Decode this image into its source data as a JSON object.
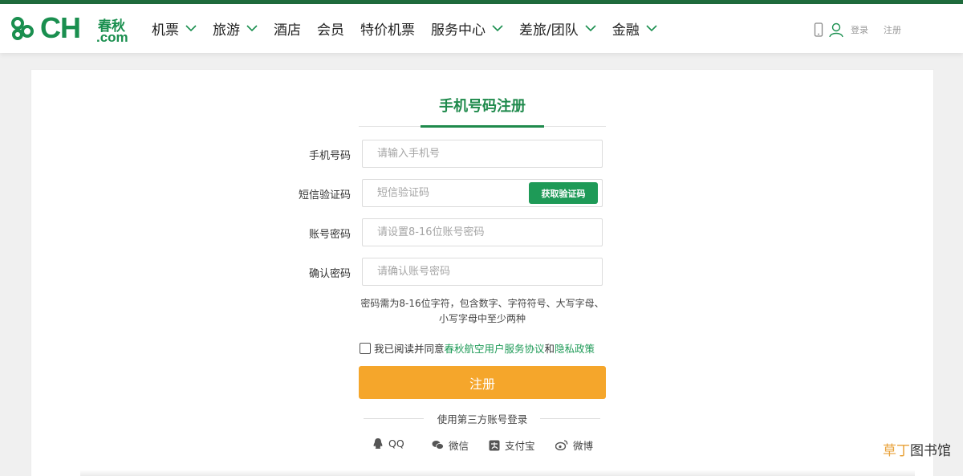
{
  "brand": {
    "logo_text": "CH",
    "logo_cn": "春秋",
    "logo_domain": ".com",
    "primary_color": "#1a8f4f",
    "accent_color": "#f5a62b"
  },
  "nav": [
    {
      "label": "机票",
      "dropdown": true
    },
    {
      "label": "旅游",
      "dropdown": true
    },
    {
      "label": "酒店",
      "dropdown": false
    },
    {
      "label": "会员",
      "dropdown": false
    },
    {
      "label": "特价机票",
      "dropdown": false
    },
    {
      "label": "服务中心",
      "dropdown": true
    },
    {
      "label": "差旅/团队",
      "dropdown": true
    },
    {
      "label": "金融",
      "dropdown": true
    }
  ],
  "header_right": {
    "login": "登录",
    "register": "注册",
    "icons": [
      "mobile-icon",
      "user-icon"
    ]
  },
  "form": {
    "tab_title": "手机号码注册",
    "phone": {
      "label": "手机号码",
      "placeholder": "请输入手机号",
      "value": ""
    },
    "sms_code": {
      "label": "短信验证码",
      "placeholder": "短信验证码",
      "value": "",
      "button": "获取验证码"
    },
    "password": {
      "label": "账号密码",
      "placeholder": "请设置8-16位账号密码",
      "value": ""
    },
    "confirm": {
      "label": "确认密码",
      "placeholder": "请确认账号密码",
      "value": ""
    },
    "hint": "密码需为8-16位字符，包含数字、字符符号、大写字母、小写字母中至少两种",
    "agree": {
      "prefix": "我已阅读并同意",
      "link1": "春秋航空用户服务协议",
      "and": "和",
      "link2": "隐私政策",
      "checked": false
    },
    "submit": "注册"
  },
  "third_party": {
    "title": "使用第三方账号登录",
    "items": [
      {
        "label": "QQ",
        "icon": "qq-icon"
      },
      {
        "label": "微信",
        "icon": "wechat-icon"
      },
      {
        "label": "支付宝",
        "icon": "alipay-icon"
      },
      {
        "label": "微博",
        "icon": "weibo-icon"
      }
    ]
  },
  "watermark": {
    "part1": "草丁",
    "part2": "图书馆"
  }
}
